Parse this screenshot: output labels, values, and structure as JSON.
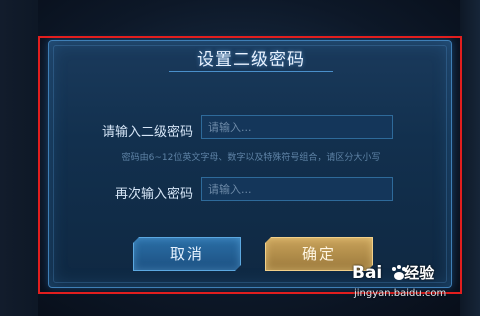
{
  "dialog": {
    "title": "设置二级密码",
    "password_label": "请输入二级密码",
    "password_placeholder": "请输入...",
    "hint": "密码由6~12位英文字母、数字以及特殊符号组合，请区分大小写",
    "confirm_label": "再次输入密码",
    "confirm_placeholder": "请输入...",
    "cancel_button": "取消",
    "ok_button": "确定"
  },
  "watermark": {
    "logo": "Bai",
    "logo_tail": "经验",
    "url": "jingyan.baidu.com"
  },
  "colors": {
    "highlight_border": "#e11e1e",
    "cancel_accent": "#2a6ea6",
    "confirm_accent": "#c8a25a"
  }
}
